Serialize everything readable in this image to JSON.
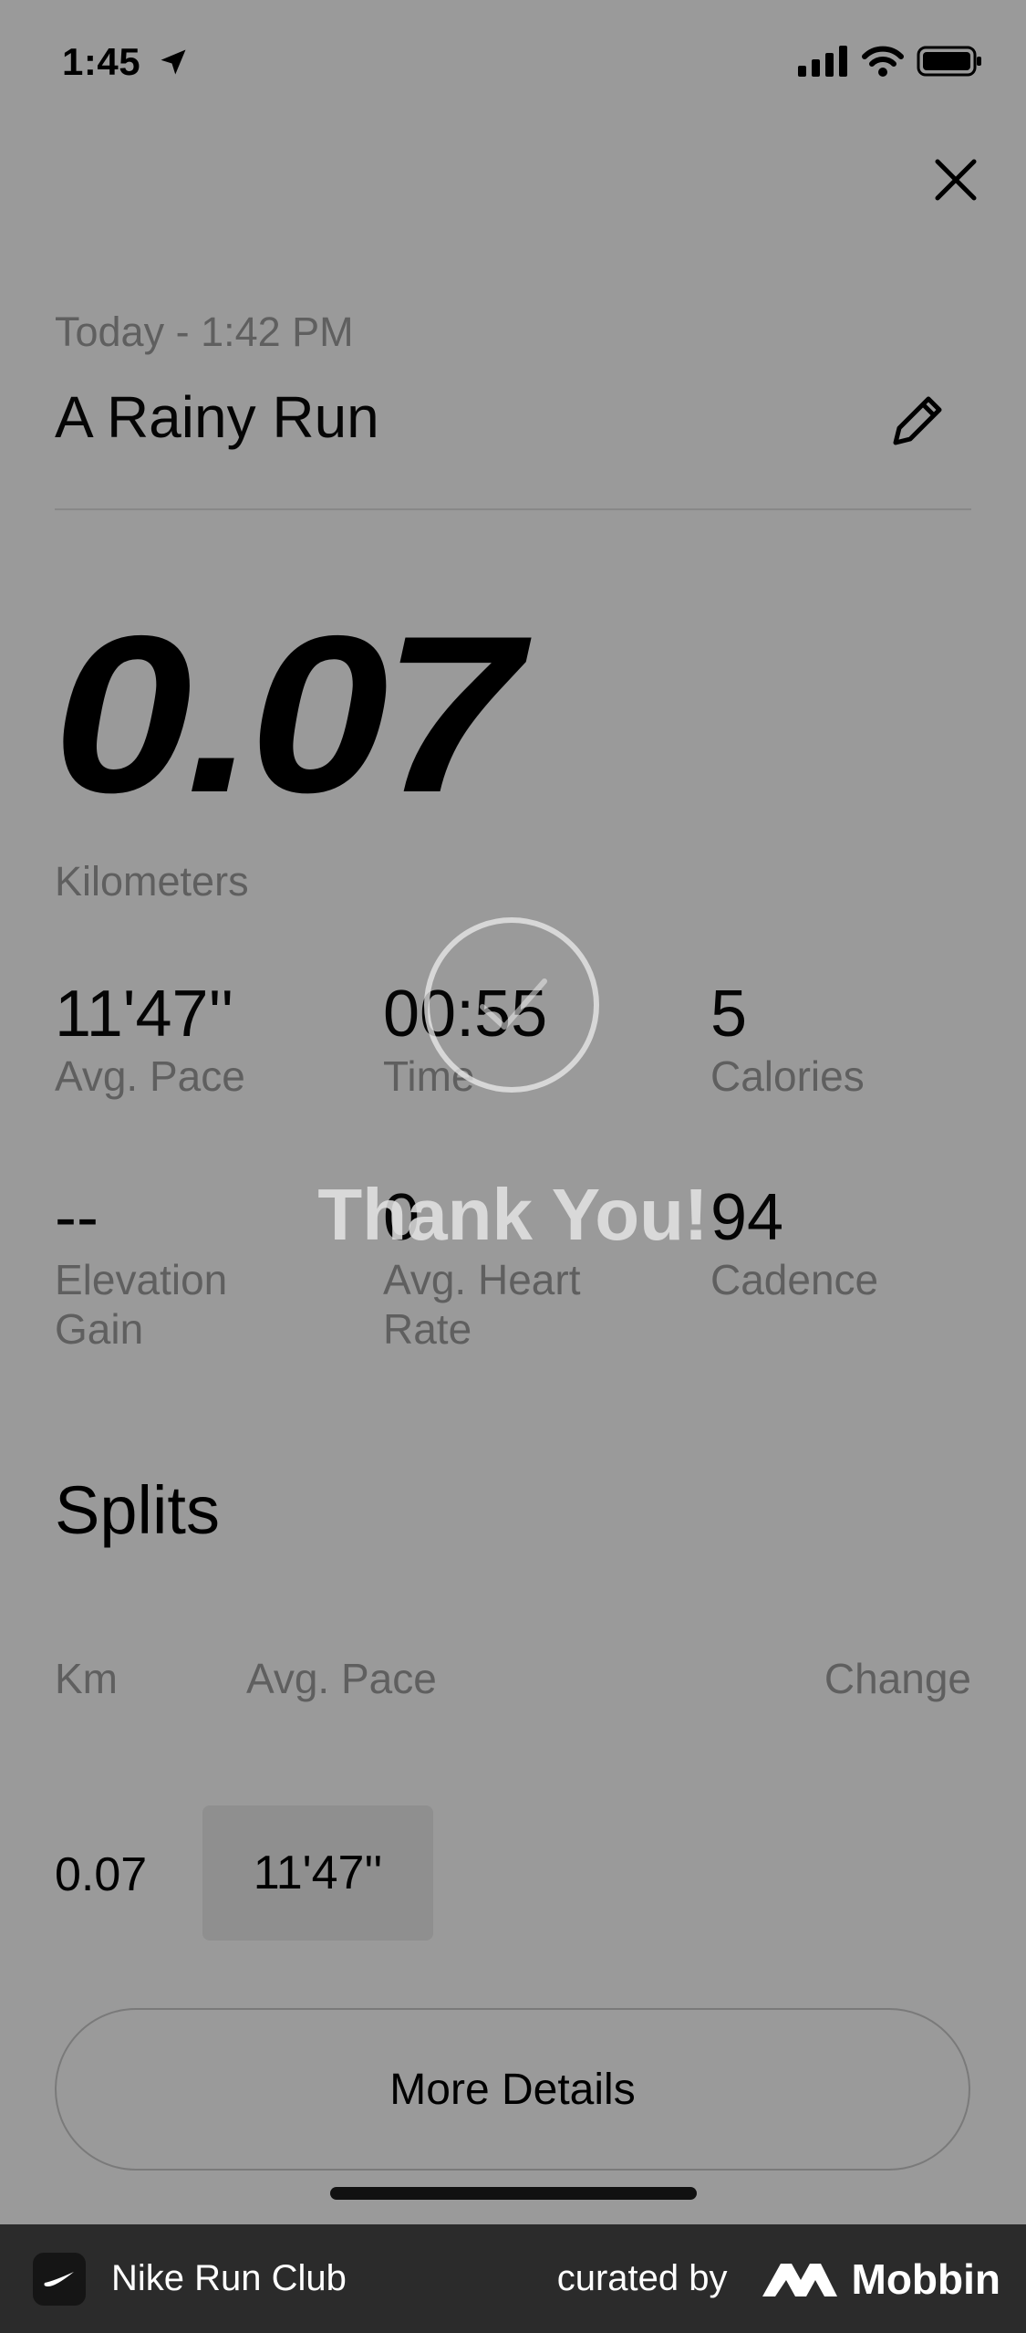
{
  "status_bar": {
    "time": "1:45"
  },
  "header": {
    "subtitle": "Today - 1:42 PM",
    "title": "A Rainy Run"
  },
  "distance": {
    "value": "0.07",
    "unit": "Kilometers"
  },
  "stats": [
    {
      "value": "11'47''",
      "label": "Avg. Pace"
    },
    {
      "value": "00:55",
      "label": "Time"
    },
    {
      "value": "5",
      "label": "Calories"
    },
    {
      "value": "--",
      "label": "Elevation Gain"
    },
    {
      "value": "0",
      "label": "Avg. Heart Rate"
    },
    {
      "value": "94",
      "label": "Cadence"
    }
  ],
  "splits": {
    "title": "Splits",
    "columns": [
      "Km",
      "Avg. Pace",
      "Change"
    ],
    "rows": [
      {
        "km": "0.07",
        "pace": "11'47''"
      }
    ]
  },
  "more_details_label": "More Details",
  "overlay": {
    "text": "Thank You!"
  },
  "footer": {
    "app_name": "Nike Run Club",
    "curated_by": "curated by",
    "brand": "Mobbin"
  }
}
